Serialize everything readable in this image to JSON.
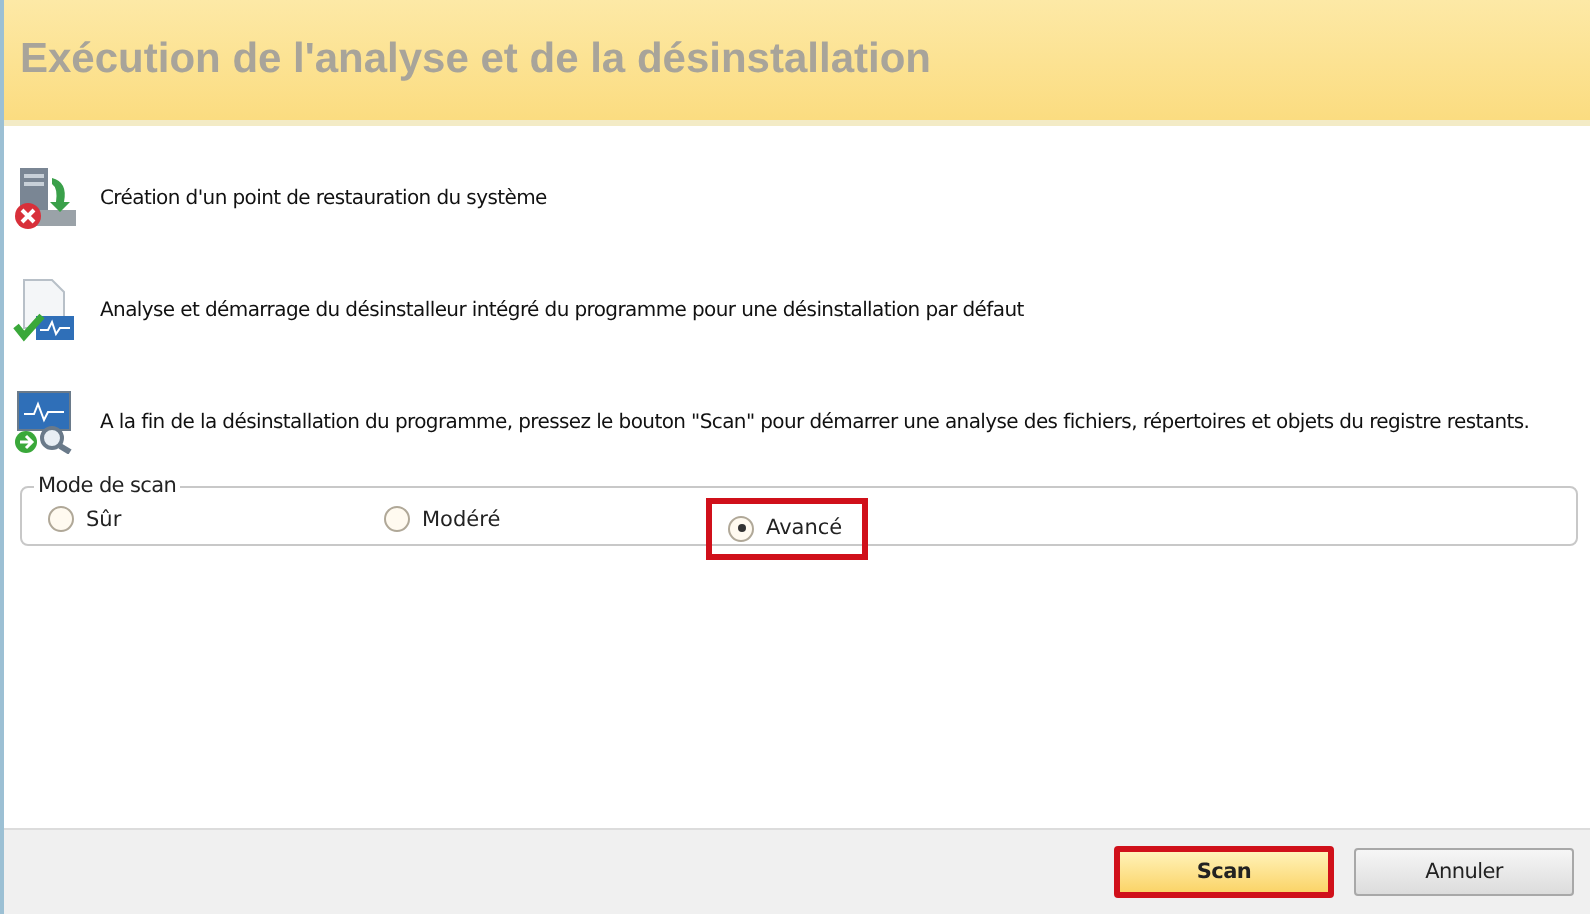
{
  "header": {
    "title": "Exécution de l'analyse et de la désinstallation"
  },
  "steps": [
    {
      "kind": "restore",
      "text": "Création d'un point de restauration du système"
    },
    {
      "kind": "uninstall",
      "text": "Analyse et démarrage du désinstalleur intégré du programme pour une désinstallation par défaut"
    },
    {
      "kind": "scan",
      "text": "A la fin de la désinstallation du programme, pressez le bouton \"Scan\" pour démarrer une analyse des fichiers, répertoires et objets du registre restants."
    }
  ],
  "scan_mode": {
    "label": "Mode de scan",
    "options": [
      {
        "label": "Sûr",
        "selected": false,
        "highlighted": false
      },
      {
        "label": "Modéré",
        "selected": false,
        "highlighted": false
      },
      {
        "label": "Avancé",
        "selected": true,
        "highlighted": true
      }
    ]
  },
  "buttons": [
    {
      "label": "Scan",
      "primary": true,
      "highlighted": true
    },
    {
      "label": "Annuler",
      "primary": false,
      "highlighted": false
    }
  ]
}
